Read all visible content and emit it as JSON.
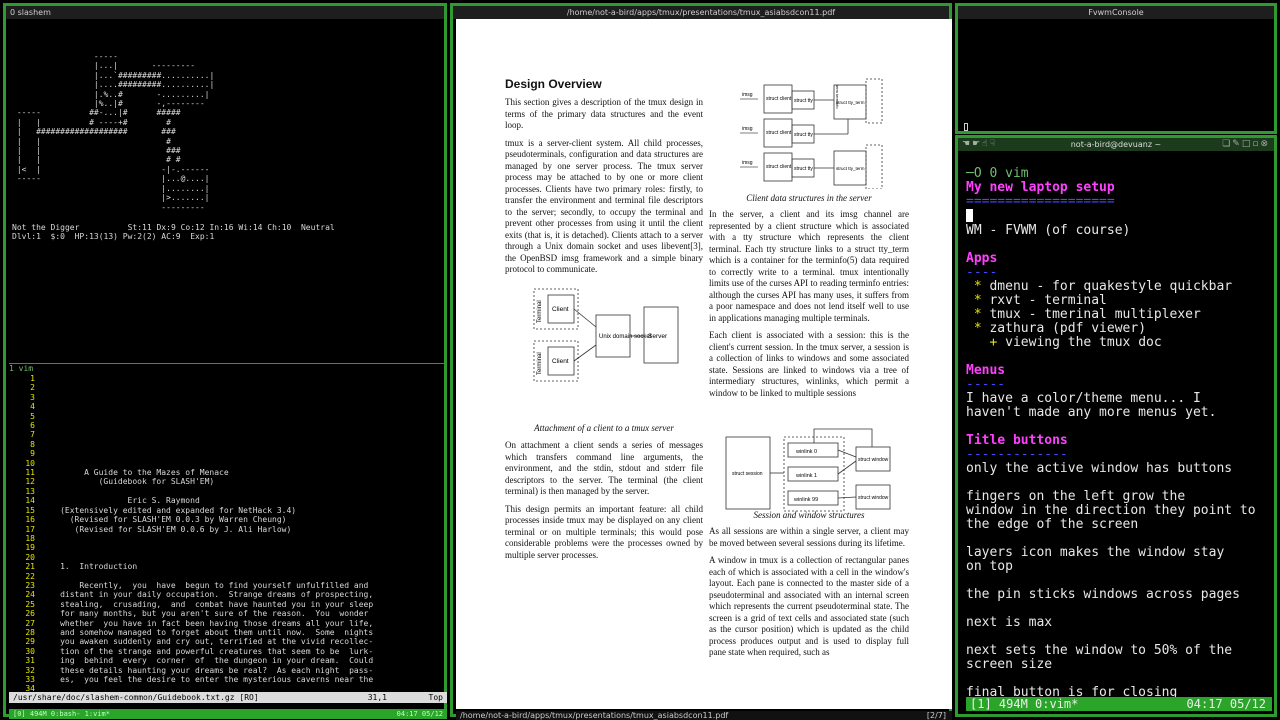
{
  "left_window": {
    "title": "0 slashem",
    "map": [
      "                 -----",
      "                 |...|       ---------",
      "                 |...`#########..........|",
      "                 |....#########..........|",
      "                 |.%..#       -.........|",
      "                 |%..|#       -,--------",
      " -----          ##-...|#      #####",
      " |   |          # ----+#        #",
      " |   ###################       ###",
      " |   |                          #",
      " |   |                          ###",
      " |   |                          # #",
      " |<  |                         -|-.------",
      " -----                         |...@....|",
      "                               |........|",
      "                               |>.......|",
      "                               ---------"
    ],
    "status_lines": [
      "Not the Digger          St:11 Dx:9 Co:12 In:16 Wi:14 Ch:10  Neutral",
      "Dlvl:1  $:0  HP:13(13) Pw:2(2) AC:9  Exp:1"
    ],
    "vim_title": "1 vim",
    "line_numbers": [
      "1",
      "2",
      "3",
      "4",
      "5",
      "6",
      "7",
      "8",
      "9",
      "10",
      "11",
      "12",
      "13",
      "14",
      "15",
      "16",
      "17",
      "18",
      "19",
      "20",
      "21",
      "22",
      "23",
      "24",
      "25",
      "26",
      "27",
      "28",
      "29",
      "30",
      "31",
      "32",
      "33",
      "34"
    ],
    "guidebook_lines": [
      "",
      "",
      "",
      "",
      "",
      "",
      "",
      "",
      "",
      "",
      "          A Guide to the Mazes of Menace",
      "             (Guidebook for SLASH'EM)",
      "",
      "                   Eric S. Raymond",
      "     (Extensively edited and expanded for NetHack 3.4)",
      "       (Revised for SLASH'EM 0.0.3 by Warren Cheung)",
      "        (Revised for SLASH'EM 0.0.6 by J. Ali Harlow)",
      "",
      "",
      "",
      "     1.  Introduction",
      "",
      "         Recently,  you  have  begun to find yourself unfulfilled and",
      "     distant in your daily occupation.  Strange dreams of prospecting,",
      "     stealing,  crusading,  and  combat have haunted you in your sleep",
      "     for many months, but you aren't sure of the reason.  You  wonder",
      "     whether  you have in fact been having those dreams all your life,",
      "     and somehow managed to forget about them until now.  Some  nights",
      "     you awaken suddenly and cry out, terrified at the vivid recollec-",
      "     tion of the strange and powerful creatures that seem to be  lurk-",
      "     ing  behind  every  corner  of  the dungeon in your dream.  Could",
      "     these details haunting your dreams be real?  As each night  pass-",
      "     es,  you feel the desire to enter the mysterious caverns near the",
      ""
    ],
    "vim_status_left": "/usr/share/doc/slashem-common/Guidebook.txt.gz [RO]",
    "vim_status_pos": "31,1",
    "vim_status_scroll": "Top",
    "tmux_bar_left": "[0] 494M 0:bash- 1:vim*",
    "tmux_bar_right": "04:17 05/12"
  },
  "pdf_window": {
    "title": "/home/not-a-bird/apps/tmux/presentations/tmux_asiabsdcon11.pdf",
    "heading": "Design Overview",
    "col1_paras": [
      "This section gives a description of the tmux design in terms of the primary data structures and the event loop.",
      "tmux is a server-client system. All child processes, pseudoterminals, configuration and data structures are managed by one server process. The tmux server process may be attached to by one or more client processes. Clients have two primary roles: firstly, to transfer the environment and terminal file descriptors to the server; secondly, to occupy the terminal and prevent other processes from using it until the client exits (that is, it is detached). Clients attach to a server through a Unix domain socket and uses libevent[3], the OpenBSD imsg framework and a simple binary protocol to communicate."
    ],
    "fig2_caption": "Attachment of a client to a tmux server",
    "fig2_labels": {
      "terminal": "Terminal",
      "client": "Client",
      "socket": "Unix domain socket",
      "server": "Server"
    },
    "col1_paras_b": [
      "On attachment a client sends a series of messages which transfers command line arguments, the environment, and the stdin, stdout and stderr file descriptors to the server. The terminal (the client terminal) is then managed by the server.",
      "This design permits an important feature: all child processes inside tmux may be displayed on any client terminal or on multiple terminals; this would pose considerable problems were the processes owned by multiple server processes."
    ],
    "fig1_caption": "Client data structures in the server",
    "fig1_labels": {
      "imsg": "imsg",
      "client": "struct client",
      "tty": "struct tty",
      "ttyterm": "struct tty_term",
      "terminfo": "term terminfo"
    },
    "col2_paras": [
      "In the server, a client and its imsg channel are represented by a client structure which is associated with a tty structure which represents the client terminal. Each tty structure links to a struct tty_term which is a container for the terminfo(5) data required to correctly write to a terminal. tmux intentionally limits use of the curses API to reading terminfo entries: although the curses API has many uses, it suffers from a poor namespace and does not lend itself well to use in applications managing multiple terminals.",
      "Each client is associated with a session: this is the client's current session. In the tmux server, a session is a collection of links to windows and some associated state. Sessions are linked to windows via a tree of intermediary structures, winlinks, which permit a window to be linked to multiple sessions"
    ],
    "fig3_caption": "Session and window structures",
    "fig3_labels": {
      "session": "struct session",
      "w0": "winlink 0",
      "w1": "winlink 1",
      "w99": "winlink 99",
      "window": "struct window"
    },
    "col2_paras_b": [
      "As all sessions are within a single server, a client may be moved between several sessions during its lifetime.",
      "A window in tmux is a collection of rectangular panes each of which is associated with a cell in the window's layout. Each pane is connected to the master side of a pseudoterminal and associated with an internal screen which represents the current pseudoterminal state. The screen is a grid of text cells and associated state (such as the cursor position) which is updated as the child process produces output and is used to display full pane state when required, such as"
    ],
    "status_path": "/home/not-a-bird/apps/tmux/presentations/tmux_asiabsdcon11.pdf",
    "status_page": "[2/7]"
  },
  "console_window": {
    "title": "FvwmConsole"
  },
  "notes_window": {
    "title": "not-a-bird@devuanz ~",
    "vim_title": "0 vim",
    "heading": "My new laptop setup",
    "heading_rule": "===================",
    "wm_line": "WM - FVWM (of course)",
    "apps_heading": "Apps",
    "apps_rule": "----",
    "apps": [
      " * dmenu - for quakestyle quickbar",
      " * rxvt - terminal",
      " * tmux - tmerinal multiplexer",
      " * zathura (pdf viewer)",
      "   + viewing the tmux doc"
    ],
    "menus_heading": "Menus",
    "menus_rule": "-----",
    "menus_text": "I have a color/theme menu... I\nhaven't made any more menus yet.",
    "title_heading": "Title buttons",
    "title_rule": "-------------",
    "title_lines": [
      "only the active window has buttons",
      "",
      "fingers on the left grow the",
      "window in the direction they point to",
      "the edge of the screen",
      "",
      "layers icon makes the window stay",
      "on top",
      "",
      "the pin sticks windows across pages",
      "",
      "next is max",
      "",
      "next sets the window to 50% of the",
      "screen size",
      "",
      "final button is for closing"
    ],
    "tmux_bar_left": "[1] 494M 0:vim*",
    "tmux_bar_right": "04:17 05/12"
  }
}
